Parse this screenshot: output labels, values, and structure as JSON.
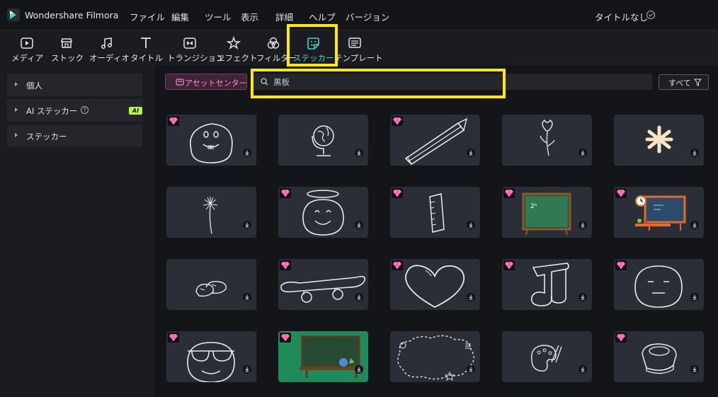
{
  "app": {
    "name": "Wondershare Filmora",
    "project_title": "タイトルなし"
  },
  "menu": [
    "ファイル",
    "編集",
    "ツール",
    "表示",
    "詳細",
    "ヘルプ",
    "バージョン"
  ],
  "toolbar": [
    {
      "label": "メディア",
      "icon": "media-icon"
    },
    {
      "label": "ストック",
      "icon": "stock-icon"
    },
    {
      "label": "オーディオ",
      "icon": "audio-icon"
    },
    {
      "label": "タイトル",
      "icon": "title-icon"
    },
    {
      "label": "トランジション",
      "icon": "transition-icon"
    },
    {
      "label": "エフェクト",
      "icon": "effect-icon"
    },
    {
      "label": "フィルター",
      "icon": "filter-icon"
    },
    {
      "label": "ステッカー",
      "icon": "sticker-icon",
      "active": true
    },
    {
      "label": "テンプレート",
      "icon": "template-icon"
    }
  ],
  "sidebar": [
    {
      "label": "個人"
    },
    {
      "label": "AI ステッカー",
      "badge": "AI"
    },
    {
      "label": "ステッカー"
    }
  ],
  "asset_center": {
    "label": "アセットセンター"
  },
  "search": {
    "value": "黒板"
  },
  "filter": {
    "label": "すべて"
  },
  "colors": {
    "accent": "#3fd8c5",
    "highlight": "#ffea00",
    "premium": "#ff4fa3",
    "ai_badge": "#b6f24b"
  },
  "stickers": [
    {
      "subject": "smiling-blob",
      "premium": true
    },
    {
      "subject": "globe",
      "premium": false
    },
    {
      "subject": "pencil",
      "premium": true
    },
    {
      "subject": "flower",
      "premium": false
    },
    {
      "subject": "asterisk",
      "premium": false
    },
    {
      "subject": "dandelion",
      "premium": false
    },
    {
      "subject": "angel-face",
      "premium": true
    },
    {
      "subject": "ruler",
      "premium": true
    },
    {
      "subject": "chalkboard",
      "premium": true
    },
    {
      "subject": "classroom",
      "premium": true
    },
    {
      "subject": "shoes",
      "premium": false
    },
    {
      "subject": "skateboard",
      "premium": true
    },
    {
      "subject": "heart",
      "premium": true
    },
    {
      "subject": "music-note",
      "premium": true
    },
    {
      "subject": "neutral-face",
      "premium": true
    },
    {
      "subject": "sunglasses-face",
      "premium": true
    },
    {
      "subject": "classroom-scene",
      "premium": true
    },
    {
      "subject": "cloud-frame",
      "premium": false
    },
    {
      "subject": "palette",
      "premium": false
    },
    {
      "subject": "speaker-device",
      "premium": true
    }
  ]
}
